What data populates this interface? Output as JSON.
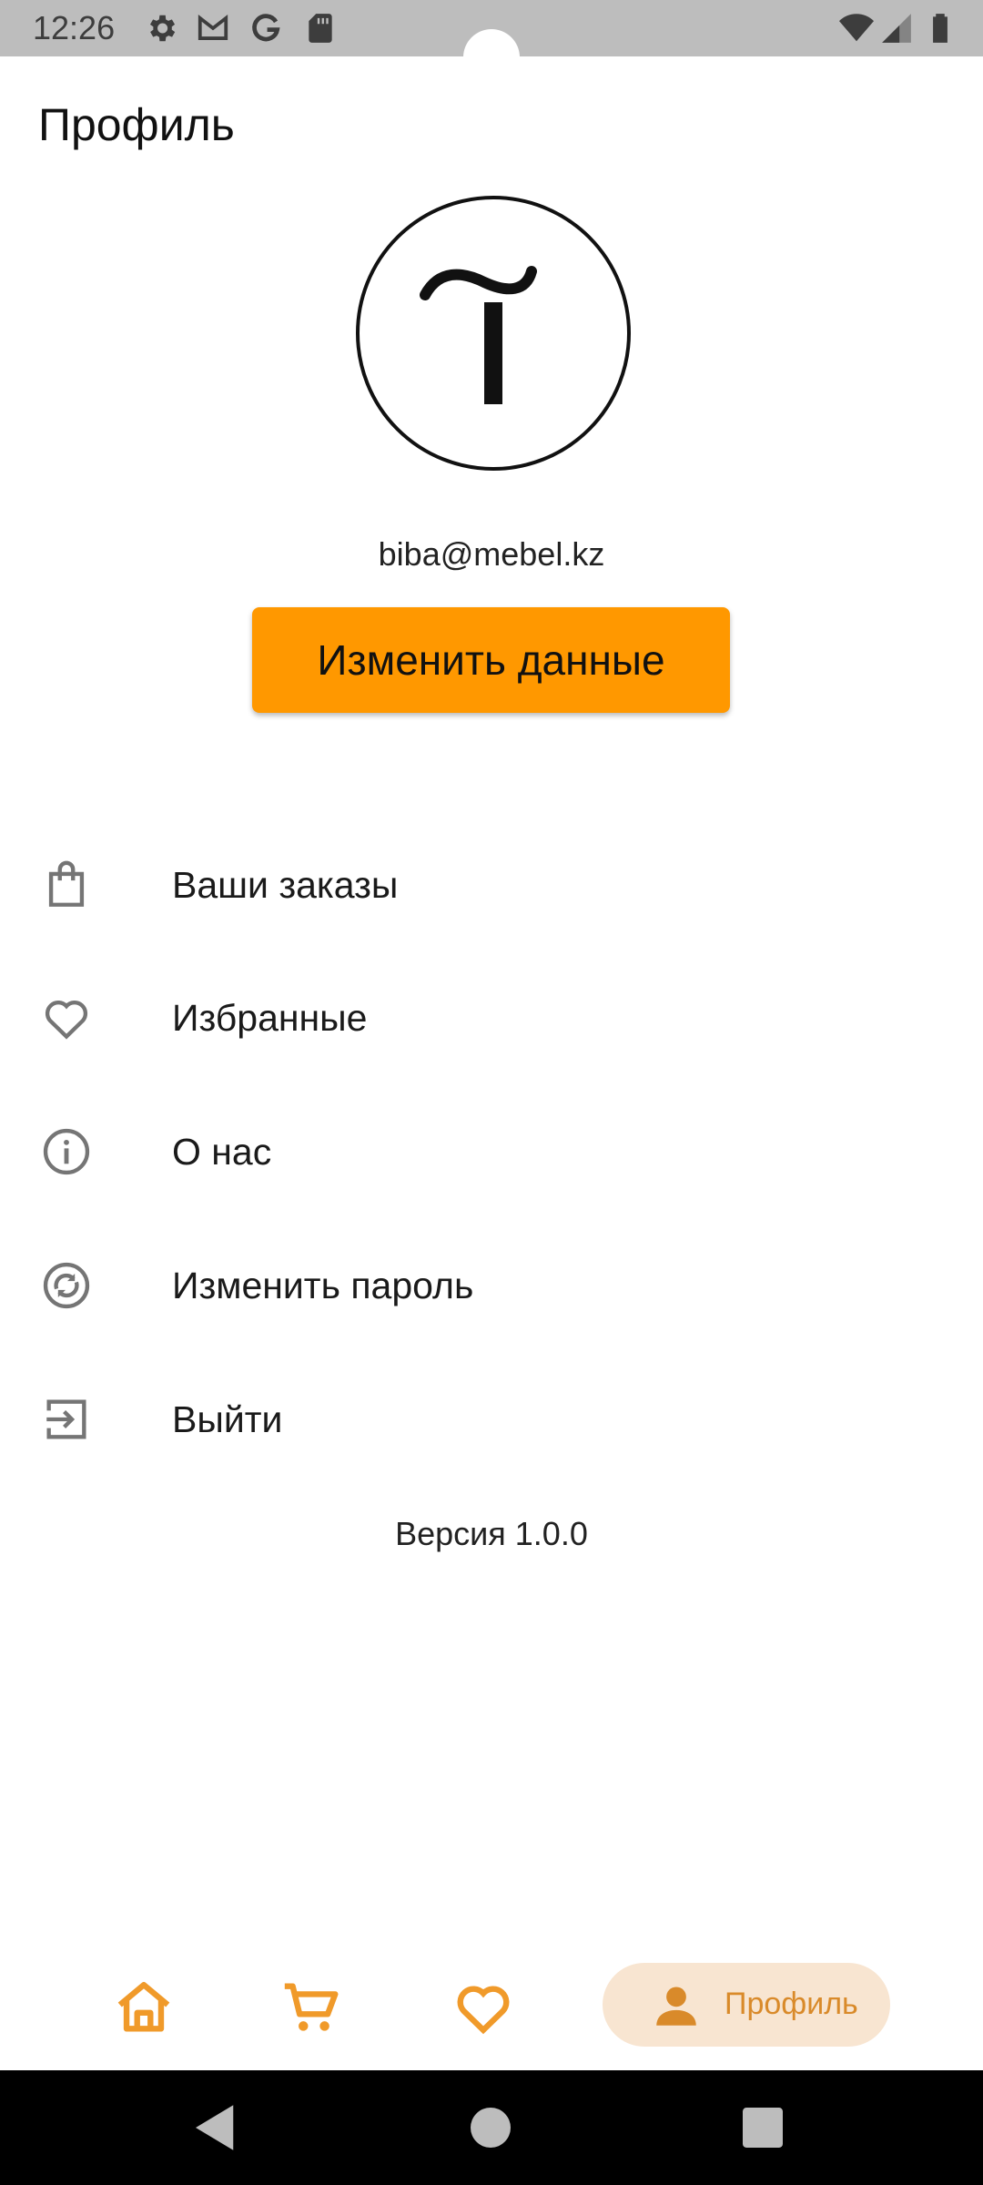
{
  "status_bar": {
    "time": "12:26",
    "left_icons": [
      "gear-icon",
      "gmail-icon",
      "google-icon",
      "sd-card-icon"
    ],
    "right_icons": [
      "wifi-icon",
      "signal-icon",
      "battery-icon"
    ]
  },
  "header": {
    "title": "Профиль"
  },
  "profile": {
    "email": "biba@mebel.kz",
    "edit_button_label": "Изменить данные",
    "avatar_icon": "tilda-logo"
  },
  "menu": {
    "items": [
      {
        "label": "Ваши заказы",
        "icon": "shopping-bag-icon"
      },
      {
        "label": "Избранные",
        "icon": "heart-icon"
      },
      {
        "label": "О нас",
        "icon": "info-icon"
      },
      {
        "label": "Изменить пароль",
        "icon": "sync-lock-icon"
      },
      {
        "label": "Выйти",
        "icon": "logout-icon"
      }
    ]
  },
  "version_text": "Версия 1.0.0",
  "bottom_nav": {
    "items": [
      {
        "icon": "home-icon"
      },
      {
        "icon": "cart-icon"
      },
      {
        "icon": "heart-icon"
      },
      {
        "icon": "person-icon",
        "label": "Профиль",
        "active": true
      }
    ]
  },
  "colors": {
    "accent": "#ff9800",
    "nav_icon": "#f09a2a",
    "nav_active_bg": "#f8e5d1",
    "menu_icon": "#757575"
  }
}
